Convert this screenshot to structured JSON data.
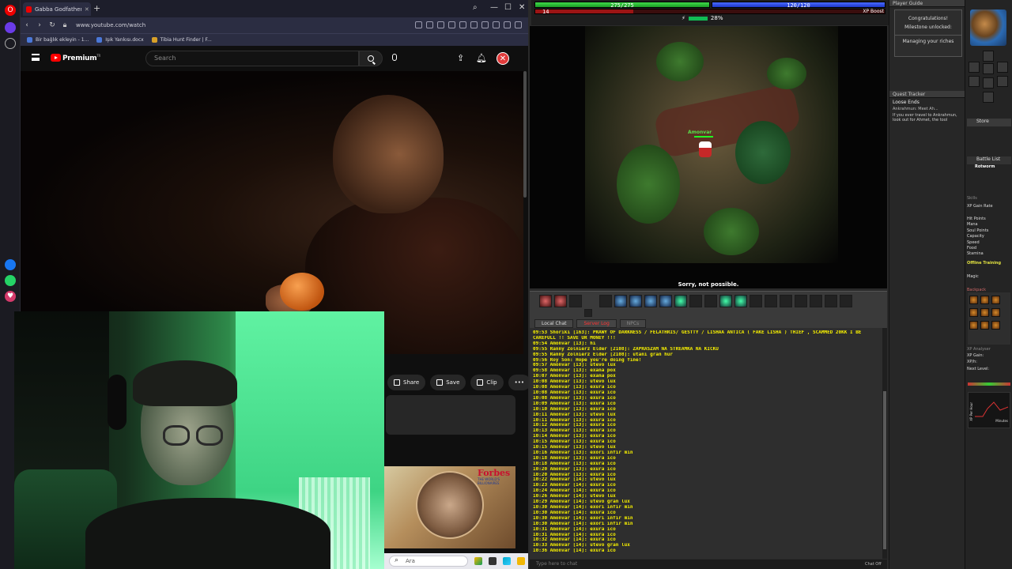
{
  "browser": {
    "tab_title": "Gabba Godfather Fi",
    "url": "www.youtube.com/watch",
    "bookmarks": [
      "Bir bağlık ekleyin - 1...",
      "Işık Yankısı.docx",
      "Tibia Hunt Finder | F..."
    ],
    "yt": {
      "brand": "Premium",
      "brand_sup": "TR",
      "search_placeholder": "Search"
    },
    "actions": [
      "Share",
      "Save",
      "Clip"
    ],
    "thumb_brand": "Forbes",
    "thumb_sub": "THE WORLD'S BILLIONAIRES",
    "taskbar_search": "Ara"
  },
  "game": {
    "hp": "275/275",
    "hp_fraction": 1.0,
    "mana": "120/120",
    "mana_fraction": 1.0,
    "level": "14",
    "xp_fraction": 0.28,
    "xp_pct": "28%",
    "xp_boost": "XP Boost",
    "player_name": "Amonvar",
    "status_msg": "Sorry, not possible.",
    "chat_tabs": [
      "Local Chat",
      "Server Log",
      "NPCs"
    ],
    "chat_lines": [
      "09:53 Shoriki [163]: PRAWY OF DARKNESS / FELATHRIS/ GESTTY / LISHAA ANTICA ( FAKE LISHA ) THIEF , SCAMMED 20KK I BE",
      "       CAREFULL !! SAVE UR MONEY !!!",
      "09:54 Amonvar [13]: hi",
      "09:55 Ranny Zolnierz Elder [2108]: ZAPRASZAM NA STREAMKA NA KICKU",
      "09:55 Ranny Zolnierz Elder [2108]: utani gran hur",
      "09:56 Roy Son: Hope you're doing fine!",
      "09:57 Amonvar [13]: utevo lux",
      "09:58 Amonvar [13]: exana pox",
      "10:07 Amonvar [13]: exana pox",
      "10:08 Amonvar [13]: utevo lux",
      "10:08 Amonvar [13]: exura ico",
      "10:08 Amonvar [13]: exura ico",
      "10:08 Amonvar [13]: exura ico",
      "10:09 Amonvar [13]: exura ico",
      "10:10 Amonvar [13]: exura ico",
      "10:11 Amonvar [13]: utevo lux",
      "10:11 Amonvar [13]: exura ico",
      "10:12 Amonvar [13]: exura ico",
      "10:13 Amonvar [13]: exura ico",
      "10:14 Amonvar [13]: exura ico",
      "10:15 Amonvar [13]: exura ico",
      "10:15 Amonvar [13]: utevo lux",
      "10:16 Amonvar [13]: exori infir min",
      "10:18 Amonvar [13]: exura ico",
      "10:18 Amonvar [13]: exura ico",
      "10:20 Amonvar [13]: exura ico",
      "10:20 Amonvar [13]: exura ico",
      "10:22 Amonvar [14]: utevo lux",
      "10:23 Amonvar [14]: exura ico",
      "10:24 Amonvar [14]: exura ico",
      "10:26 Amonvar [14]: utevo lux",
      "10:29 Amonvar [14]: utevo gran lux",
      "10:30 Amonvar [14]: exori infir min",
      "10:30 Amonvar [14]: exura ico",
      "10:30 Amonvar [14]: exori infir min",
      "10:30 Amonvar [14]: exori infir min",
      "10:31 Amonvar [14]: exura ico",
      "10:31 Amonvar [14]: exura ico",
      "10:32 Amonvar [14]: exura ico",
      "10:33 Amonvar [14]: utevo gran lux",
      "10:36 Amonvar [14]: exura ico"
    ],
    "chat_placeholder": "Type here to chat",
    "chat_off": "Chat Off",
    "player_guide": "Player Guide",
    "guide_text1": "Congratulations!",
    "guide_text2": "Milestone unlocked:",
    "guide_text3": "Managing your riches",
    "quest_tracker": "Quest Tracker",
    "quest_name": "Loose Ends",
    "quest_sub": "Ankrahmun: Meet Ah...",
    "quest_desc": "If you ever travel to Ankrahmun, look out for Ahmet, the tool",
    "store": "Store",
    "battle_list": "Battle List",
    "battle_target": "Rotworm",
    "skills_title": "Skills",
    "xp_gain_rate": "XP Gain Rate",
    "skill_rows": [
      "Hit Points",
      "Mana",
      "Soul Points",
      "Capacity",
      "Speed",
      "Food",
      "Stamina"
    ],
    "offline_training": "Offline Training",
    "magic": "Magic",
    "backpack": "Backpack",
    "xp_analyser": "XP Analyser",
    "xp_gain": "XP Gain:",
    "xp_h": "XP/h:",
    "next_level": "Next Level:",
    "graph_y": "XP Per Hour",
    "graph_x": "Minutes"
  }
}
